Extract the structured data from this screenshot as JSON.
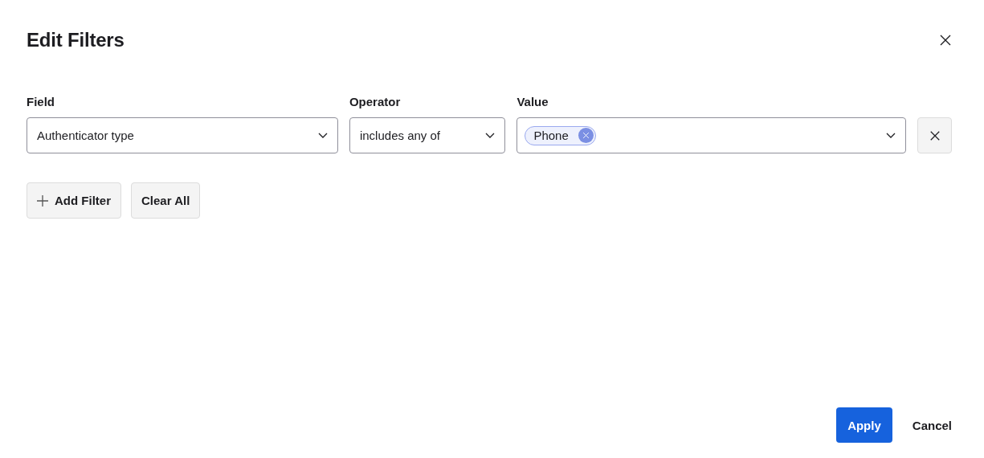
{
  "dialog": {
    "title": "Edit Filters"
  },
  "filters": [
    {
      "field": {
        "label": "Field",
        "value": "Authenticator type"
      },
      "operator": {
        "label": "Operator",
        "value": "includes any of"
      },
      "value": {
        "label": "Value",
        "chips": [
          "Phone"
        ]
      }
    }
  ],
  "actions": [
    {
      "label": "Add Filter",
      "kind": "add"
    },
    {
      "label": "Clear All",
      "kind": "plain"
    }
  ],
  "footer": [
    {
      "label": "Apply",
      "kind": "primary"
    },
    {
      "label": "Cancel",
      "kind": "link"
    }
  ]
}
